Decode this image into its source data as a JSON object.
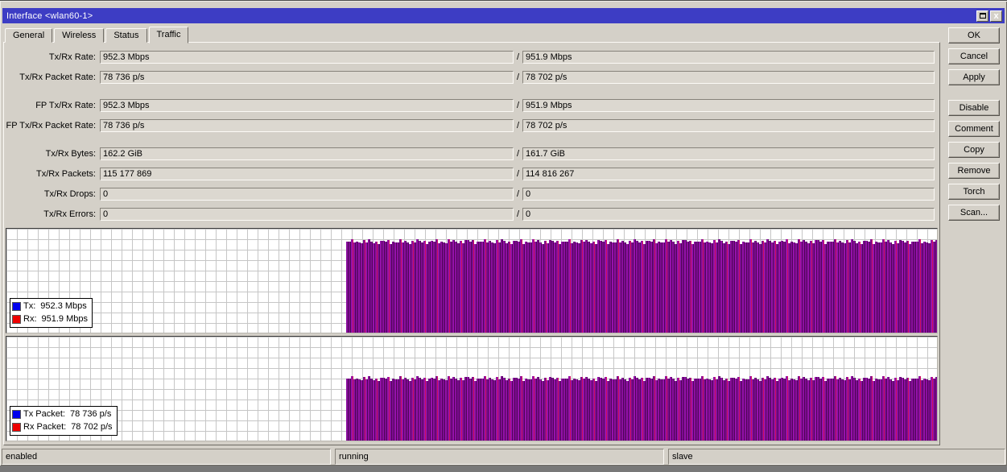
{
  "titlebar": {
    "title": "Interface <wlan60-1>",
    "buttons": {
      "restore": "restore-window",
      "close": "close-window",
      "close_glyph": "x"
    }
  },
  "tabs": [
    {
      "label": "General"
    },
    {
      "label": "Wireless"
    },
    {
      "label": "Status"
    },
    {
      "label": "Traffic",
      "active": true
    }
  ],
  "field_separator": "/",
  "fields": [
    {
      "label": "Tx/Rx Rate:",
      "tx": "952.3 Mbps",
      "rx": "951.9 Mbps"
    },
    {
      "label": "Tx/Rx Packet Rate:",
      "tx": "78 736 p/s",
      "rx": "78 702 p/s"
    },
    {
      "label": "FP Tx/Rx Rate:",
      "tx": "952.3 Mbps",
      "rx": "951.9 Mbps"
    },
    {
      "label": "FP Tx/Rx Packet Rate:",
      "tx": "78 736 p/s",
      "rx": "78 702 p/s"
    },
    {
      "label": "Tx/Rx Bytes:",
      "tx": "162.2 GiB",
      "rx": "161.7 GiB"
    },
    {
      "label": "Tx/Rx Packets:",
      "tx": "115 177 869",
      "rx": "114 816 267"
    },
    {
      "label": "Tx/Rx Drops:",
      "tx": "0",
      "rx": "0"
    },
    {
      "label": "Tx/Rx Errors:",
      "tx": "0",
      "rx": "0"
    }
  ],
  "action_buttons": [
    "OK",
    "Cancel",
    "Apply",
    "Disable",
    "Comment",
    "Copy",
    "Remove",
    "Torch",
    "Scan..."
  ],
  "status_bar": {
    "items": [
      "enabled",
      "running",
      "slave"
    ]
  },
  "chart_data": [
    {
      "type": "bar",
      "title": "Tx/Rx rate over time",
      "unit": "Mbps",
      "x_axis": "time, rolling window (newest at right)",
      "grid": true,
      "legend_position": "bottom-left",
      "series": [
        {
          "name": "Tx",
          "color": "#0000ff",
          "current_value": 952.3
        },
        {
          "name": "Rx",
          "color": "#ff0000",
          "current_value": 951.9
        }
      ],
      "timeline": {
        "idle_fraction": 0.365,
        "active_fraction": 0.635,
        "idle_value": 0
      },
      "plot_level_fraction": 0.875,
      "legend": [
        {
          "color": "#0000ff",
          "label": "Tx:",
          "value": "952.3 Mbps"
        },
        {
          "color": "#ff0000",
          "label": "Rx:",
          "value": "951.9 Mbps"
        }
      ]
    },
    {
      "type": "bar",
      "title": "Tx/Rx packet rate over time",
      "unit": "p/s",
      "x_axis": "time, rolling window (newest at right)",
      "grid": true,
      "legend_position": "bottom-left",
      "series": [
        {
          "name": "Tx Packet",
          "color": "#0000ff",
          "current_value": 78736
        },
        {
          "name": "Rx Packet",
          "color": "#ff0000",
          "current_value": 78702
        }
      ],
      "timeline": {
        "idle_fraction": 0.365,
        "active_fraction": 0.635,
        "idle_value": 0
      },
      "plot_level_fraction": 0.6,
      "legend": [
        {
          "color": "#0000ff",
          "label": "Tx Packet:",
          "value": "78 736 p/s"
        },
        {
          "color": "#ff0000",
          "label": "Rx Packet:",
          "value": "78 702 p/s"
        }
      ]
    }
  ]
}
